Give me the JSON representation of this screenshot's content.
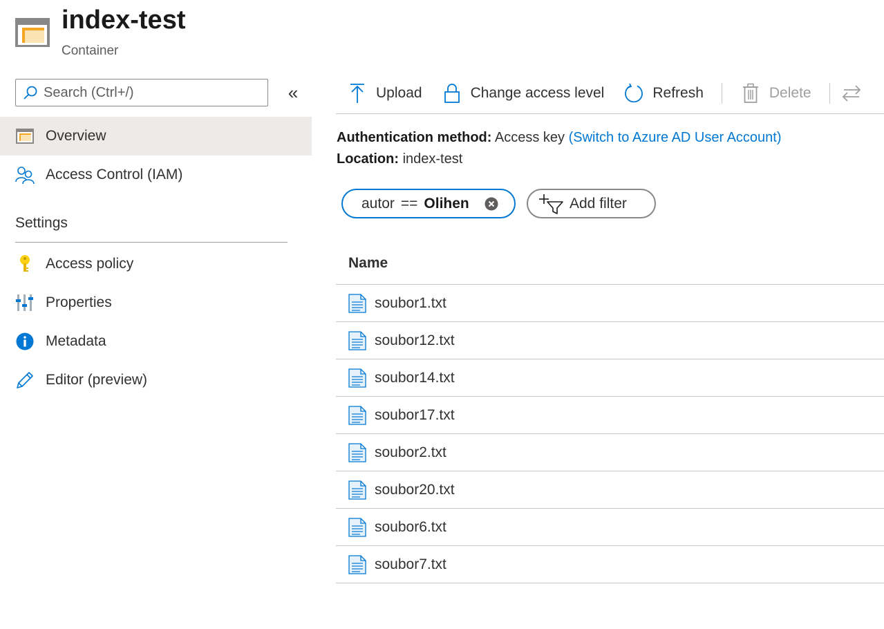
{
  "header": {
    "title": "index-test",
    "subtitle": "Container",
    "icon": "container-icon"
  },
  "sidebar": {
    "search": {
      "placeholder": "Search (Ctrl+/)",
      "value": ""
    },
    "collapse_label": "«",
    "items": [
      {
        "label": "Overview",
        "icon": "container-icon",
        "active": true
      },
      {
        "label": "Access Control (IAM)",
        "icon": "people-icon",
        "active": false
      }
    ],
    "settings_heading": "Settings",
    "settings_items": [
      {
        "label": "Access policy",
        "icon": "key-icon"
      },
      {
        "label": "Properties",
        "icon": "sliders-icon"
      },
      {
        "label": "Metadata",
        "icon": "info-icon"
      },
      {
        "label": "Editor (preview)",
        "icon": "pencil-icon"
      }
    ]
  },
  "toolbar": {
    "upload_label": "Upload",
    "access_label": "Change access level",
    "refresh_label": "Refresh",
    "delete_label": "Delete"
  },
  "info": {
    "auth_label": "Authentication method:",
    "auth_value": "Access key",
    "auth_link": "(Switch to Azure AD User Account)",
    "location_label": "Location:",
    "location_value": "index-test"
  },
  "filter": {
    "key": "autor",
    "operator": "==",
    "value": "Olihen",
    "add_label": "Add filter"
  },
  "table": {
    "column_name": "Name",
    "rows": [
      {
        "name": "soubor1.txt"
      },
      {
        "name": "soubor12.txt"
      },
      {
        "name": "soubor14.txt"
      },
      {
        "name": "soubor17.txt"
      },
      {
        "name": "soubor2.txt"
      },
      {
        "name": "soubor20.txt"
      },
      {
        "name": "soubor6.txt"
      },
      {
        "name": "soubor7.txt"
      }
    ]
  },
  "colors": {
    "accent": "#0078d4",
    "active_nav_bg": "#edebe9",
    "disabled_text": "#a19f9d"
  }
}
